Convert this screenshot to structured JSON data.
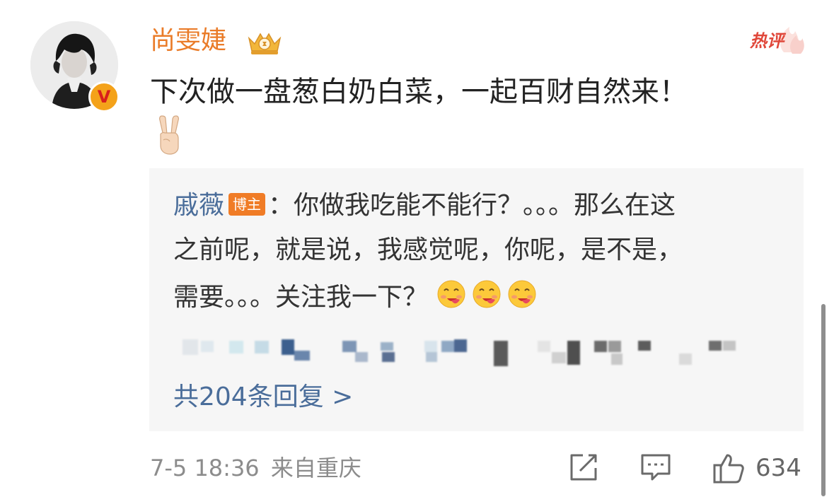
{
  "comment": {
    "username": "尚雯婕",
    "hot_label": "热评",
    "text": "下次做一盘葱白奶白菜，一起百财自然来！",
    "verified_badge": "V",
    "icons": [
      "verified-icon",
      "crown-badge-icon",
      "victory-hand-emoji"
    ]
  },
  "reply": {
    "author": "戚薇",
    "author_tag": "博主",
    "line1": "：你做我吃能不能行？。。。那么在这",
    "line2": "之前呢，就是说，我感觉呢，你呢，是不是，",
    "line3": "需要。。。关注我一下？",
    "emojis": [
      "yummy-face-emoji",
      "yummy-face-emoji",
      "yummy-face-emoji"
    ],
    "count_text": "共204条回复 >"
  },
  "footer": {
    "time": "7-5 18:36",
    "location": "来自重庆",
    "like_count": "634",
    "icons": [
      "share-icon",
      "comment-icon",
      "thumbs-up-icon"
    ]
  },
  "colors": {
    "username": "#ea7c29",
    "reply_author": "#4a6d9a",
    "hot": "#e0473a",
    "tag": "#f07c26"
  }
}
